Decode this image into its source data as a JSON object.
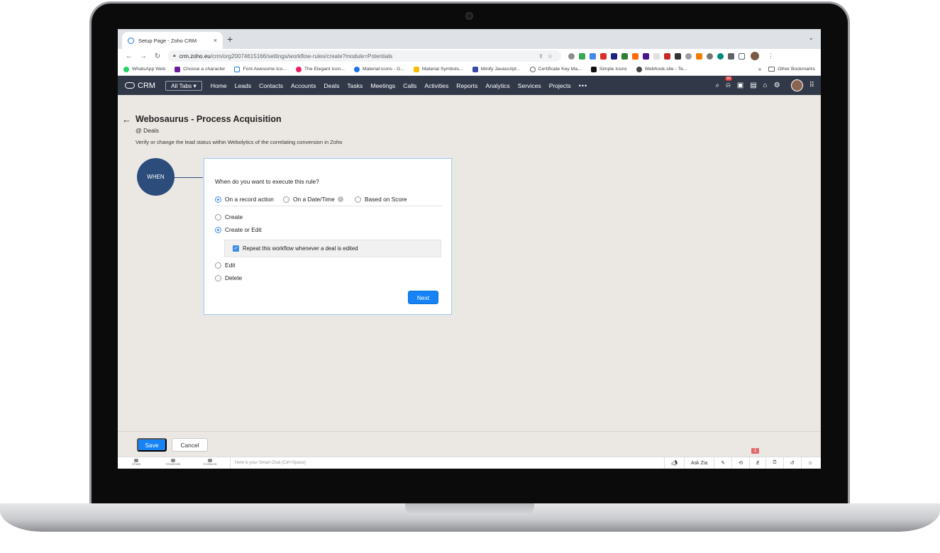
{
  "browser": {
    "tab_title": "Setup Page - Zoho CRM",
    "tab_close": "×",
    "new_tab": "+",
    "tab_menu": "⌄",
    "url_host": "crm.zoho.eu",
    "url_path": "/crm/org20074615166/settings/workflow-rules/create?module=Potentials",
    "bookmarks": [
      {
        "label": "WhatsApp Web",
        "color": "#25d366"
      },
      {
        "label": "Choose a character",
        "color": "#6a1b9a"
      },
      {
        "label": "Font Awesome Ico...",
        "color": "#1a73e8"
      },
      {
        "label": "The Elegant Icon...",
        "color": "#e91e63"
      },
      {
        "label": "Material icons - G...",
        "color": "#1a73e8"
      },
      {
        "label": "Material Symbols...",
        "color": "#fbbc04"
      },
      {
        "label": "Minify Javascript...",
        "color": "#3949ab"
      },
      {
        "label": "Certificate Key Ma...",
        "color": "#5f6368"
      },
      {
        "label": "Simple Icons",
        "color": "#111111"
      },
      {
        "label": "Webhook.site - Te...",
        "color": "#444444"
      }
    ],
    "bookmarks_more": "»",
    "other_bookmarks": "Other Bookmarks"
  },
  "nav": {
    "logo": "CRM",
    "all_tabs": "All Tabs ▾",
    "items": [
      "Home",
      "Leads",
      "Contacts",
      "Accounts",
      "Deals",
      "Tasks",
      "Meetings",
      "Calls",
      "Activities",
      "Reports",
      "Analytics",
      "Services",
      "Projects"
    ],
    "more": "•••",
    "notification_count": "50"
  },
  "page": {
    "back_arrow": "←",
    "title": "Webosaurus - Process Acquisition",
    "module": "@ Deals",
    "description": "Verify or change the lead status within Webolytics of the correlating conversion in Zoho",
    "when_label": "WHEN"
  },
  "rule": {
    "question": "When do you want to execute this rule?",
    "triggers": [
      {
        "label": "On a record action",
        "selected": true
      },
      {
        "label": "On a Date/Time",
        "selected": false
      },
      {
        "label": "Based on Score",
        "selected": false
      }
    ],
    "info_icon": "i",
    "actions": [
      {
        "label": "Create",
        "selected": false
      },
      {
        "label": "Create or Edit",
        "selected": true
      },
      {
        "label": "Edit",
        "selected": false
      },
      {
        "label": "Delete",
        "selected": false
      }
    ],
    "repeat_label": "Repeat this workflow whenever a deal is edited",
    "repeat_checked": true,
    "next_label": "Next"
  },
  "footer": {
    "save_label": "Save",
    "cancel_label": "Cancel"
  },
  "chatbar": {
    "tabs": [
      "Chats",
      "Channels",
      "Contacts"
    ],
    "placeholder": "Here is your Smart Chat (Ctrl+Space)",
    "ask_zia": "Ask Zia",
    "badge": "1"
  }
}
